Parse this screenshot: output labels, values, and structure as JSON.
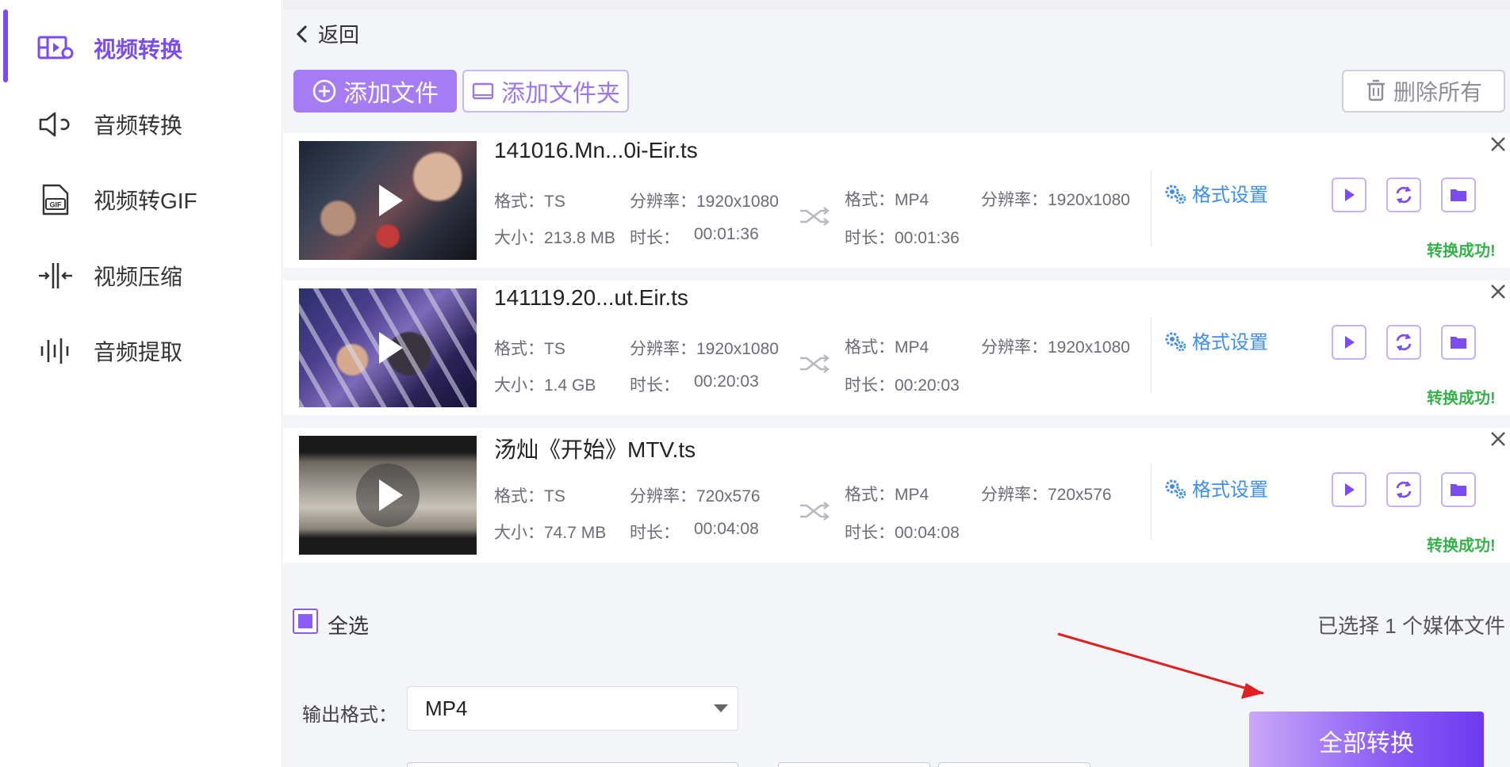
{
  "sidebar": {
    "items": [
      {
        "label": "视频转换",
        "icon": "video-convert-icon",
        "active": true
      },
      {
        "label": "音频转换",
        "icon": "speaker-icon",
        "active": false
      },
      {
        "label": "视频转GIF",
        "icon": "gif-file-icon",
        "active": false
      },
      {
        "label": "视频压缩",
        "icon": "compress-icon",
        "active": false
      },
      {
        "label": "音频提取",
        "icon": "waveform-icon",
        "active": false
      }
    ]
  },
  "header": {
    "back_label": "返回"
  },
  "toolbar": {
    "add_file_label": "添加文件",
    "add_folder_label": "添加文件夹",
    "delete_all_label": "删除所有"
  },
  "files": [
    {
      "name": "141016.Mn...0i-Eir.ts",
      "src_format": "格式：TS",
      "src_resolution": "分辨率：1920x1080",
      "src_size": "大小：213.8 MB",
      "src_duration_label": "时长：",
      "src_duration": "00:01:36",
      "dst_format": "格式：MP4",
      "dst_resolution": "分辨率：1920x1080",
      "dst_duration": "时长：00:01:36",
      "format_settings": "格式设置",
      "status": "转换成功!"
    },
    {
      "name": "141119.20...ut.Eir.ts",
      "src_format": "格式：TS",
      "src_resolution": "分辨率：1920x1080",
      "src_size": "大小：1.4 GB",
      "src_duration_label": "时长：",
      "src_duration": "00:20:03",
      "dst_format": "格式：MP4",
      "dst_resolution": "分辨率：1920x1080",
      "dst_duration": "时长：00:20:03",
      "format_settings": "格式设置",
      "status": "转换成功!"
    },
    {
      "name": "汤灿《开始》MTV.ts",
      "src_format": "格式：TS",
      "src_resolution": "分辨率：720x576",
      "src_size": "大小：74.7 MB",
      "src_duration_label": "时长：",
      "src_duration": "00:04:08",
      "dst_format": "格式：MP4",
      "dst_resolution": "分辨率：720x576",
      "dst_duration": "时长：00:04:08",
      "format_settings": "格式设置",
      "status": "转换成功!"
    }
  ],
  "selection": {
    "select_all_label": "全选",
    "selected_count_text": "已选择 1 个媒体文件"
  },
  "output": {
    "label": "输出格式：",
    "format_value": "MP4"
  },
  "convert_all_label": "全部转换",
  "colors": {
    "accent": "#8a5cf5",
    "link": "#3e8ef0",
    "success": "#36b24a",
    "annotation_arrow": "#e02020"
  }
}
